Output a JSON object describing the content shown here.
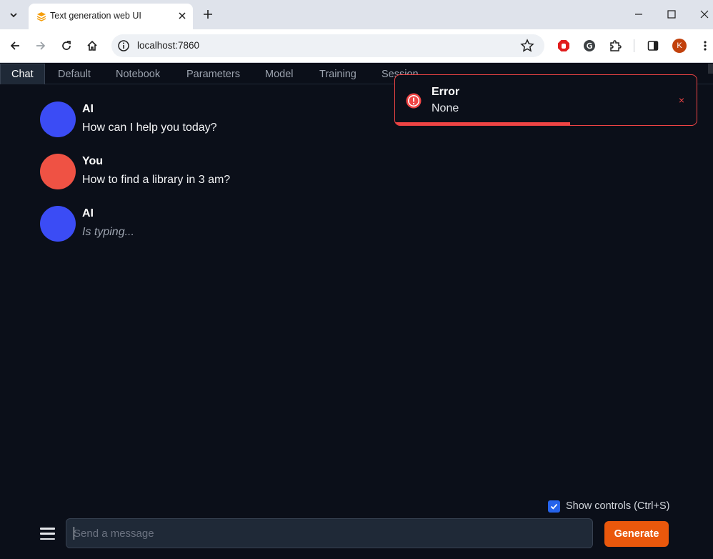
{
  "browser": {
    "tab_title": "Text generation web UI",
    "url": "localhost:7860",
    "profile_initial": "K"
  },
  "app": {
    "tabs": [
      {
        "label": "Chat"
      },
      {
        "label": "Default"
      },
      {
        "label": "Notebook"
      },
      {
        "label": "Parameters"
      },
      {
        "label": "Model"
      },
      {
        "label": "Training"
      },
      {
        "label": "Session"
      }
    ],
    "messages": [
      {
        "name": "AI",
        "text": "How can I help you today?",
        "avatar_color": "#3b4cf5"
      },
      {
        "name": "You",
        "text": "How to find a library in 3 am?",
        "avatar_color": "#ef5244"
      },
      {
        "name": "AI",
        "text": "Is typing...",
        "avatar_color": "#3b4cf5"
      }
    ],
    "toast": {
      "title": "Error",
      "message": "None",
      "close_glyph": "×",
      "progress_fraction": 0.58
    },
    "show_controls_label": "Show controls (Ctrl+S)",
    "show_controls_checked": true,
    "input_placeholder": "Send a message",
    "generate_label": "Generate"
  },
  "colors": {
    "background": "#0b0f19",
    "accent_orange": "#ea580c",
    "error_red": "#ef4444",
    "checkbox_blue": "#2563eb"
  }
}
